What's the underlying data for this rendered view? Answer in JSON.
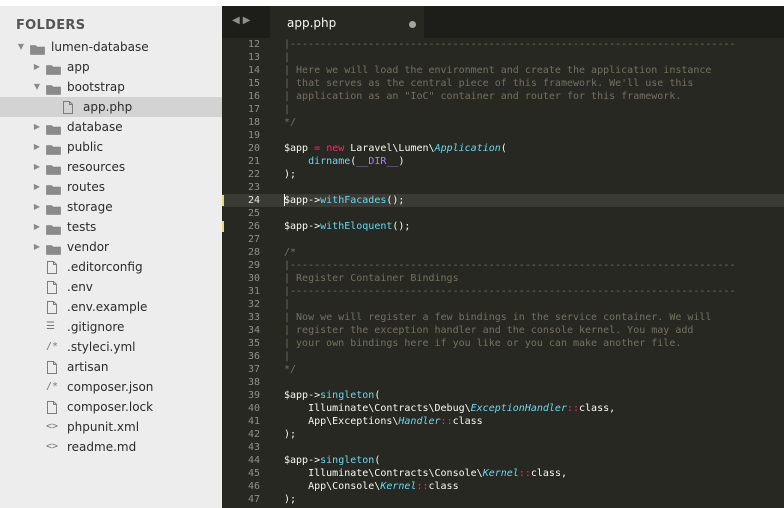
{
  "sidebar": {
    "title": "FOLDERS",
    "items": [
      {
        "label": "lumen-database",
        "type": "folder",
        "depth": 0,
        "expanded": true
      },
      {
        "label": "app",
        "type": "folder",
        "depth": 1,
        "expanded": false
      },
      {
        "label": "bootstrap",
        "type": "folder",
        "depth": 1,
        "expanded": true
      },
      {
        "label": "app.php",
        "type": "file",
        "depth": 2,
        "selected": true
      },
      {
        "label": "database",
        "type": "folder",
        "depth": 1,
        "expanded": false
      },
      {
        "label": "public",
        "type": "folder",
        "depth": 1,
        "expanded": false
      },
      {
        "label": "resources",
        "type": "folder",
        "depth": 1,
        "expanded": false
      },
      {
        "label": "routes",
        "type": "folder",
        "depth": 1,
        "expanded": false
      },
      {
        "label": "storage",
        "type": "folder",
        "depth": 1,
        "expanded": false
      },
      {
        "label": "tests",
        "type": "folder",
        "depth": 1,
        "expanded": false
      },
      {
        "label": "vendor",
        "type": "folder",
        "depth": 1,
        "expanded": false
      },
      {
        "label": ".editorconfig",
        "type": "file",
        "depth": 1
      },
      {
        "label": ".env",
        "type": "file",
        "depth": 1
      },
      {
        "label": ".env.example",
        "type": "file",
        "depth": 1
      },
      {
        "label": ".gitignore",
        "type": "list",
        "depth": 1
      },
      {
        "label": ".styleci.yml",
        "type": "comment",
        "depth": 1
      },
      {
        "label": "artisan",
        "type": "file",
        "depth": 1
      },
      {
        "label": "composer.json",
        "type": "comment",
        "depth": 1
      },
      {
        "label": "composer.lock",
        "type": "file",
        "depth": 1
      },
      {
        "label": "phpunit.xml",
        "type": "code",
        "depth": 1
      },
      {
        "label": "readme.md",
        "type": "code",
        "depth": 1
      }
    ]
  },
  "editor": {
    "nav_back": "◀",
    "nav_forward": "▶",
    "tab_title": "app.php",
    "active_line": 24,
    "marked_lines": [
      24,
      26
    ],
    "lines": [
      {
        "n": 12,
        "t": [
          [
            "c",
            "|--------------------------------------------------------------------------"
          ]
        ]
      },
      {
        "n": 13,
        "t": [
          [
            "c",
            "|"
          ]
        ]
      },
      {
        "n": 14,
        "t": [
          [
            "c",
            "| Here we will load the environment and create the application instance"
          ]
        ]
      },
      {
        "n": 15,
        "t": [
          [
            "c",
            "| that serves as the central piece of this framework. We'll use this"
          ]
        ]
      },
      {
        "n": 16,
        "t": [
          [
            "c",
            "| application as an \"IoC\" container and router for this framework."
          ]
        ]
      },
      {
        "n": 17,
        "t": [
          [
            "c",
            "|"
          ]
        ]
      },
      {
        "n": 18,
        "t": [
          [
            "c",
            "*/"
          ]
        ]
      },
      {
        "n": 19,
        "t": []
      },
      {
        "n": 20,
        "t": [
          [
            "v",
            "$app"
          ],
          [
            "p",
            " "
          ],
          [
            "o",
            "="
          ],
          [
            "p",
            " "
          ],
          [
            "k",
            "new"
          ],
          [
            "p",
            " Laravel\\Lumen\\"
          ],
          [
            "cls",
            "Application"
          ],
          [
            "p",
            "("
          ]
        ]
      },
      {
        "n": 21,
        "t": [
          [
            "p",
            "    "
          ],
          [
            "f",
            "dirname"
          ],
          [
            "p",
            "("
          ],
          [
            "const",
            "__DIR__"
          ],
          [
            "p",
            ")"
          ]
        ]
      },
      {
        "n": 22,
        "t": [
          [
            "p",
            ");"
          ]
        ]
      },
      {
        "n": 23,
        "t": []
      },
      {
        "n": 24,
        "t": [
          [
            "v",
            "$app"
          ],
          [
            "p",
            "->"
          ],
          [
            "f",
            "withFacades"
          ],
          [
            "p",
            "();"
          ]
        ]
      },
      {
        "n": 25,
        "t": []
      },
      {
        "n": 26,
        "t": [
          [
            "v",
            "$app"
          ],
          [
            "p",
            "->"
          ],
          [
            "f",
            "withEloquent"
          ],
          [
            "p",
            "();"
          ]
        ]
      },
      {
        "n": 27,
        "t": []
      },
      {
        "n": 28,
        "t": [
          [
            "c",
            "/*"
          ]
        ]
      },
      {
        "n": 29,
        "t": [
          [
            "c",
            "|--------------------------------------------------------------------------"
          ]
        ]
      },
      {
        "n": 30,
        "t": [
          [
            "c",
            "| Register Container Bindings"
          ]
        ]
      },
      {
        "n": 31,
        "t": [
          [
            "c",
            "|--------------------------------------------------------------------------"
          ]
        ]
      },
      {
        "n": 32,
        "t": [
          [
            "c",
            "|"
          ]
        ]
      },
      {
        "n": 33,
        "t": [
          [
            "c",
            "| Now we will register a few bindings in the service container. We will"
          ]
        ]
      },
      {
        "n": 34,
        "t": [
          [
            "c",
            "| register the exception handler and the console kernel. You may add"
          ]
        ]
      },
      {
        "n": 35,
        "t": [
          [
            "c",
            "| your own bindings here if you like or you can make another file."
          ]
        ]
      },
      {
        "n": 36,
        "t": [
          [
            "c",
            "|"
          ]
        ]
      },
      {
        "n": 37,
        "t": [
          [
            "c",
            "*/"
          ]
        ]
      },
      {
        "n": 38,
        "t": []
      },
      {
        "n": 39,
        "t": [
          [
            "v",
            "$app"
          ],
          [
            "p",
            "->"
          ],
          [
            "f",
            "singleton"
          ],
          [
            "p",
            "("
          ]
        ]
      },
      {
        "n": 40,
        "t": [
          [
            "p",
            "    Illuminate\\Contracts\\Debug\\"
          ],
          [
            "cls",
            "ExceptionHandler"
          ],
          [
            "o",
            "::"
          ],
          [
            "p",
            "class,"
          ]
        ]
      },
      {
        "n": 41,
        "t": [
          [
            "p",
            "    App\\Exceptions\\"
          ],
          [
            "cls",
            "Handler"
          ],
          [
            "o",
            "::"
          ],
          [
            "p",
            "class"
          ]
        ]
      },
      {
        "n": 42,
        "t": [
          [
            "p",
            ");"
          ]
        ]
      },
      {
        "n": 43,
        "t": []
      },
      {
        "n": 44,
        "t": [
          [
            "v",
            "$app"
          ],
          [
            "p",
            "->"
          ],
          [
            "f",
            "singleton"
          ],
          [
            "p",
            "("
          ]
        ]
      },
      {
        "n": 45,
        "t": [
          [
            "p",
            "    Illuminate\\Contracts\\Console\\"
          ],
          [
            "cls",
            "Kernel"
          ],
          [
            "o",
            "::"
          ],
          [
            "p",
            "class,"
          ]
        ]
      },
      {
        "n": 46,
        "t": [
          [
            "p",
            "    App\\Console\\"
          ],
          [
            "cls",
            "Kernel"
          ],
          [
            "o",
            "::"
          ],
          [
            "p",
            "class"
          ]
        ]
      },
      {
        "n": 47,
        "t": [
          [
            "p",
            ");"
          ]
        ]
      }
    ]
  },
  "colors": {
    "sidebar_bg": "#ededed",
    "editor_bg": "#272822",
    "comment": "#75715e",
    "keyword": "#f92672",
    "function": "#66d9ef",
    "constant": "#ae81ff"
  }
}
